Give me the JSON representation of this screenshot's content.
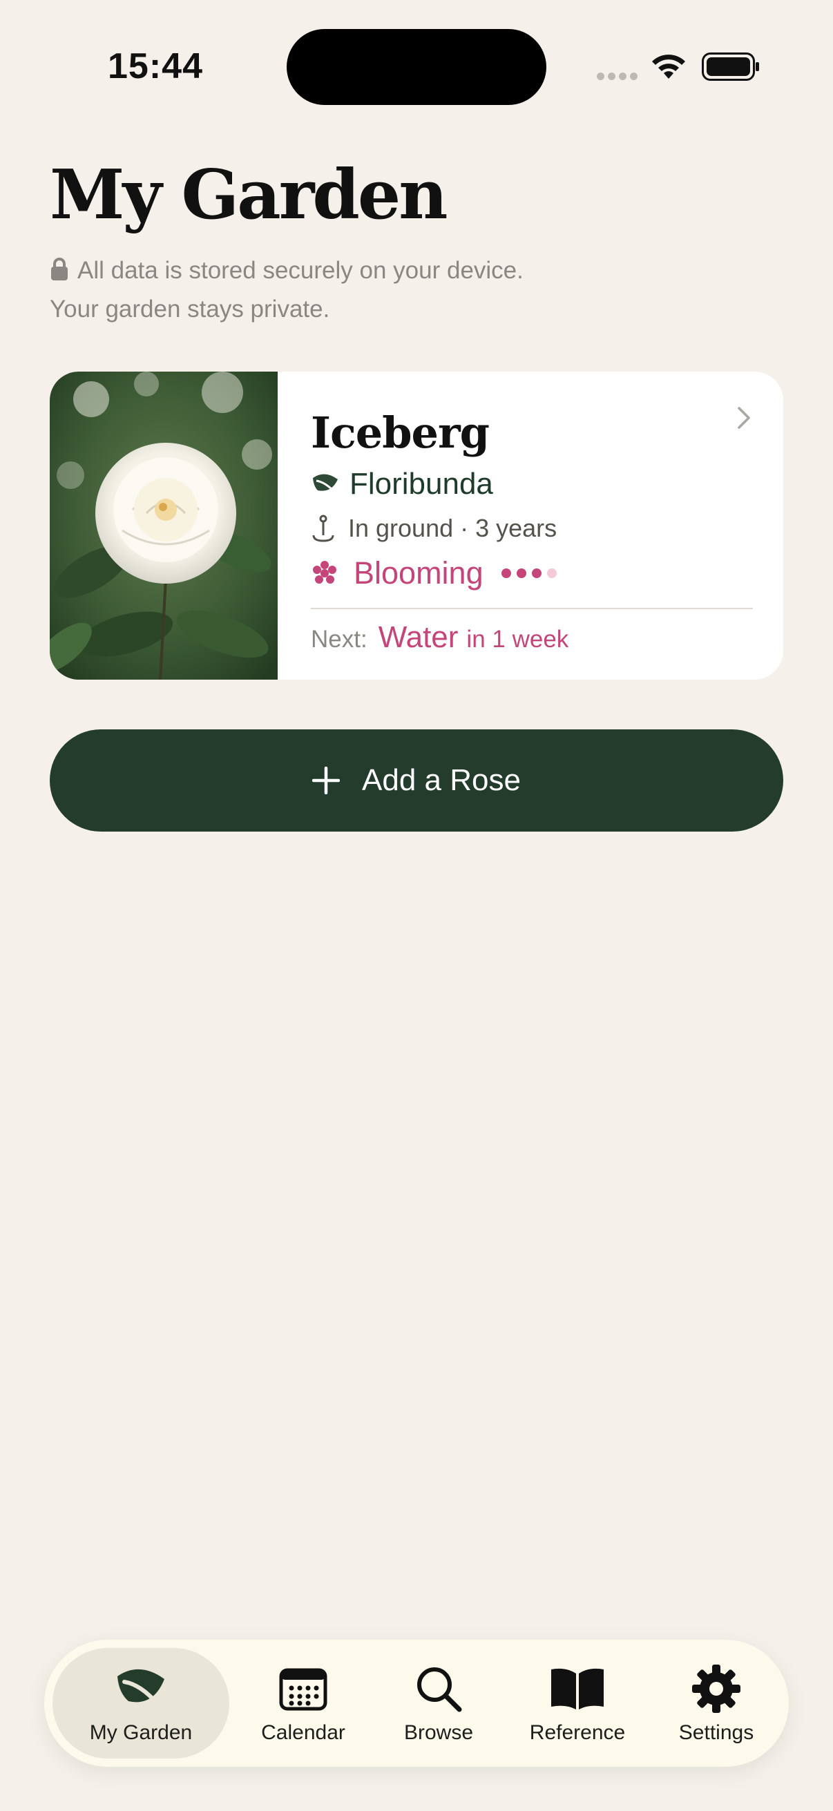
{
  "status_bar": {
    "time": "15:44"
  },
  "header": {
    "title": "My Garden",
    "privacy_line1": "All data is stored securely on your device.",
    "privacy_line2": "Your garden stays private."
  },
  "rose_card": {
    "name": "Iceberg",
    "variety": "Floribunda",
    "location": "In ground · 3 years",
    "status": "Blooming",
    "status_level": 3,
    "status_max": 4,
    "next_label": "Next:",
    "next_task": "Water",
    "next_when": "in 1 week",
    "photo_icon": "white-rose-photo"
  },
  "add_button": {
    "label": "Add a Rose"
  },
  "tabs": [
    {
      "label": "My Garden",
      "icon": "leaf-icon",
      "active": true
    },
    {
      "label": "Calendar",
      "icon": "calendar-icon",
      "active": false
    },
    {
      "label": "Browse",
      "icon": "search-icon",
      "active": false
    },
    {
      "label": "Reference",
      "icon": "book-icon",
      "active": false
    },
    {
      "label": "Settings",
      "icon": "gear-icon",
      "active": false
    }
  ],
  "colors": {
    "background": "#F5F1EA",
    "brand_green": "#233C2C",
    "accent_pink": "#C4457A",
    "tabbar": "#FDFAEC"
  }
}
